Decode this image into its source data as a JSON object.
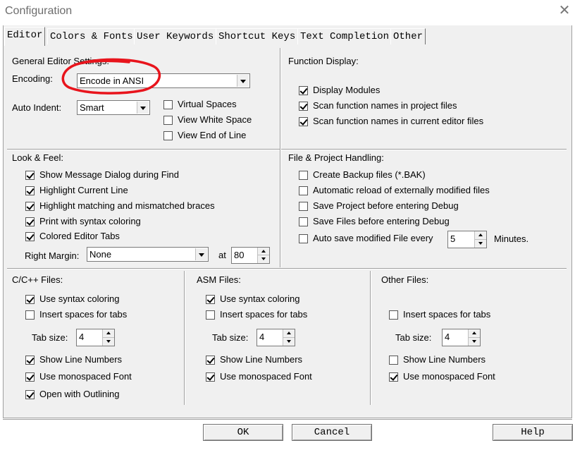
{
  "window": {
    "title": "Configuration",
    "close_glyph": "✕"
  },
  "tabs": [
    "Editor",
    "Colors & Fonts",
    "User Keywords",
    "Shortcut Keys",
    "Text Completion",
    "Other"
  ],
  "general": {
    "heading": "General Editor Settings:",
    "encoding_label": "Encoding:",
    "encoding_value": "Encode in ANSI",
    "auto_indent_label": "Auto Indent:",
    "auto_indent_value": "Smart",
    "virtual_spaces": "Virtual Spaces",
    "view_white_space": "View White Space",
    "view_end_of_line": "View End of Line"
  },
  "function_display": {
    "heading": "Function Display:",
    "display_modules": "Display Modules",
    "scan_project": "Scan function names in project files",
    "scan_current": "Scan function names in current editor files"
  },
  "look_feel": {
    "heading": "Look & Feel:",
    "show_message": "Show Message Dialog during Find",
    "highlight_line": "Highlight Current Line",
    "highlight_braces": "Highlight matching and mismatched braces",
    "print_syntax": "Print with syntax coloring",
    "colored_tabs": "Colored Editor Tabs",
    "right_margin_label": "Right Margin:",
    "right_margin_value": "None",
    "at_label": "at",
    "at_value": "80"
  },
  "file_project": {
    "heading": "File & Project Handling:",
    "create_backup": "Create Backup files (*.BAK)",
    "auto_reload": "Automatic reload of externally modified files",
    "save_project": "Save Project before entering Debug",
    "save_files": "Save Files before entering Debug",
    "auto_save": "Auto save modified File every",
    "auto_save_value": "5",
    "minutes": "Minutes."
  },
  "cpp_files": {
    "heading": "C/C++ Files:",
    "syntax": "Use syntax coloring",
    "insert_spaces": "Insert spaces for tabs",
    "tab_size_label": "Tab size:",
    "tab_size_value": "4",
    "line_numbers": "Show Line Numbers",
    "monospaced": "Use monospaced Font",
    "outlining": "Open with Outlining"
  },
  "asm_files": {
    "heading": "ASM Files:",
    "syntax": "Use syntax coloring",
    "insert_spaces": "Insert spaces for tabs",
    "tab_size_label": "Tab size:",
    "tab_size_value": "4",
    "line_numbers": "Show Line Numbers",
    "monospaced": "Use monospaced Font"
  },
  "other_files": {
    "heading": "Other Files:",
    "insert_spaces": "Insert spaces for tabs",
    "tab_size_label": "Tab size:",
    "tab_size_value": "4",
    "line_numbers": "Show Line Numbers",
    "monospaced": "Use monospaced Font"
  },
  "buttons": {
    "ok": "OK",
    "cancel": "Cancel",
    "help": "Help"
  },
  "annotation": {
    "color": "#e8141c"
  }
}
